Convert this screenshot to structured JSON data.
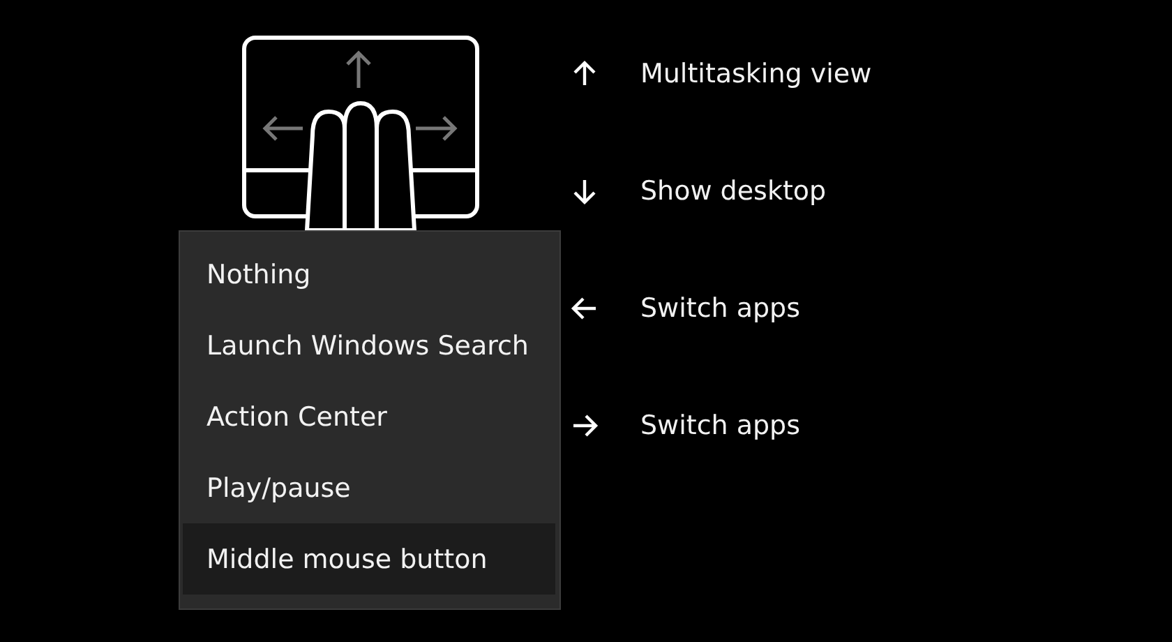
{
  "gestures": [
    {
      "kind": "up",
      "label": "Multitasking view"
    },
    {
      "kind": "down",
      "label": "Show desktop"
    },
    {
      "kind": "left",
      "label": "Switch apps"
    },
    {
      "kind": "right",
      "label": "Switch apps"
    }
  ],
  "menu": {
    "items": [
      {
        "label": "Nothing",
        "selected": false
      },
      {
        "label": "Launch Windows Search",
        "selected": false
      },
      {
        "label": "Action Center",
        "selected": false
      },
      {
        "label": "Play/pause",
        "selected": false
      },
      {
        "label": "Middle mouse button",
        "selected": true
      }
    ]
  }
}
